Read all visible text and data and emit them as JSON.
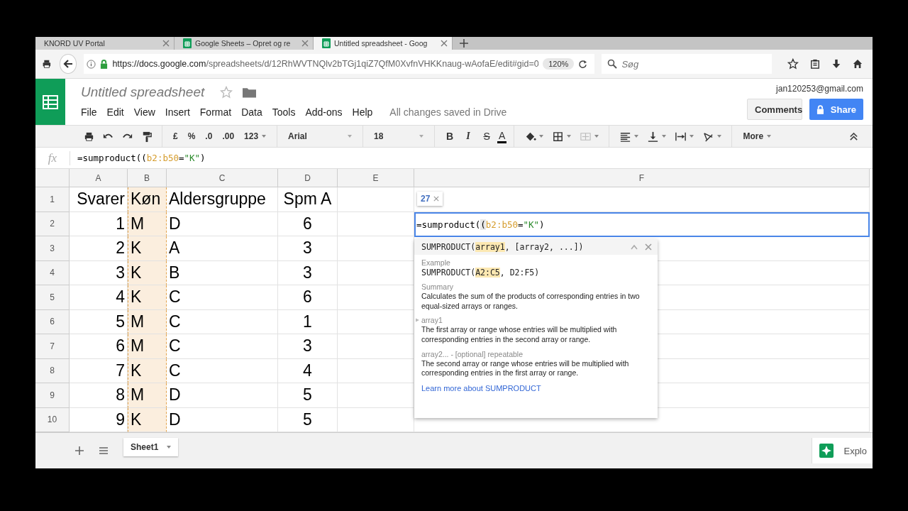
{
  "browser": {
    "tabs": [
      {
        "title": "KNORD UV Portal",
        "selected": false
      },
      {
        "title": "Google Sheets – Opret og re",
        "selected": false
      },
      {
        "title": "Untitled spreadsheet - Goog",
        "selected": true
      }
    ],
    "url_host": "https://docs.google.com",
    "url_path": "/spreadsheets/d/12RhWVTNQlv2bTGj1qiZ7QfM0XvfnVHKKnaug-wAofaE/edit#gid=0",
    "zoom": "120%",
    "search_placeholder": "Søg"
  },
  "app": {
    "title": "Untitled spreadsheet",
    "menu": [
      "File",
      "Edit",
      "View",
      "Insert",
      "Format",
      "Data",
      "Tools",
      "Add-ons",
      "Help"
    ],
    "save_status": "All changes saved in Drive",
    "account": "jan120253@gmail.com",
    "comments_button": "Comments",
    "share_button": "Share"
  },
  "toolbar": {
    "number_formats": [
      "£",
      "%",
      ".0",
      ".00",
      "123"
    ],
    "font": "Arial",
    "font_size": "18",
    "text_styles": [
      "B",
      "I",
      "S",
      "A"
    ],
    "more": "More"
  },
  "formula_bar": {
    "label": "fx",
    "formula": [
      {
        "kind": "plain",
        "text": "=sumproduct(("
      },
      {
        "kind": "range",
        "text": "b2:b50"
      },
      {
        "kind": "plain",
        "text": "="
      },
      {
        "kind": "string",
        "text": "\"K\""
      },
      {
        "kind": "plain",
        "text": ")"
      }
    ]
  },
  "columns": [
    {
      "label": "A",
      "highlighted": false
    },
    {
      "label": "B",
      "highlighted": true
    },
    {
      "label": "C",
      "highlighted": false
    },
    {
      "label": "D",
      "highlighted": false
    },
    {
      "label": "E",
      "highlighted": false
    },
    {
      "label": "F",
      "highlighted": false
    }
  ],
  "rows": [
    {
      "number": "1",
      "cells": [
        "Svarer",
        "Køn",
        "Aldersgruppe",
        "Spm A",
        "",
        ""
      ]
    },
    {
      "number": "2",
      "cells": [
        "1",
        "M",
        "D",
        "6",
        "",
        ""
      ]
    },
    {
      "number": "3",
      "cells": [
        "2",
        "K",
        "A",
        "3",
        "",
        ""
      ]
    },
    {
      "number": "4",
      "cells": [
        "3",
        "K",
        "B",
        "3",
        "",
        ""
      ]
    },
    {
      "number": "5",
      "cells": [
        "4",
        "K",
        "C",
        "6",
        "",
        ""
      ]
    },
    {
      "number": "6",
      "cells": [
        "5",
        "M",
        "C",
        "1",
        "",
        ""
      ]
    },
    {
      "number": "7",
      "cells": [
        "6",
        "M",
        "C",
        "3",
        "",
        ""
      ]
    },
    {
      "number": "8",
      "cells": [
        "7",
        "K",
        "C",
        "4",
        "",
        ""
      ]
    },
    {
      "number": "9",
      "cells": [
        "8",
        "M",
        "D",
        "5",
        "",
        ""
      ]
    },
    {
      "number": "10",
      "cells": [
        "9",
        "K",
        "D",
        "5",
        "",
        ""
      ]
    }
  ],
  "editor": {
    "chip": "27",
    "formula": [
      {
        "kind": "plain",
        "text": "=sumproduct("
      },
      {
        "kind": "paren",
        "text": "("
      },
      {
        "kind": "range",
        "text": "b2:b50"
      },
      {
        "kind": "plain",
        "text": "="
      },
      {
        "kind": "string",
        "text": "\"K\""
      },
      {
        "kind": "plain",
        "text": ")"
      }
    ]
  },
  "help": {
    "signature": [
      {
        "text": "SUMPRODUCT(",
        "highlighted": false
      },
      {
        "text": "array1",
        "highlighted": true
      },
      {
        "text": ", [array2, ...])",
        "highlighted": false
      }
    ],
    "example_label": "Example",
    "example": [
      {
        "text": "SUMPRODUCT(",
        "highlighted": false
      },
      {
        "text": "A2:C5",
        "highlighted": true
      },
      {
        "text": ", D2:F5)",
        "highlighted": false
      }
    ],
    "summary_label": "Summary",
    "summary": "Calculates the sum of the products of corresponding entries in two equal-sized arrays or ranges.",
    "args": [
      {
        "name": "array1",
        "text": "The first array or range whose entries will be multiplied with corresponding entries in the second array or range."
      },
      {
        "name": "array2... - [optional] repeatable",
        "text": "The second array or range whose entries will be multiplied with corresponding entries in the first array or range."
      }
    ],
    "link": "Learn more about SUMPRODUCT"
  },
  "sheet_tabs": [
    {
      "name": "Sheet1",
      "selected": true
    }
  ],
  "explore": "Explo"
}
